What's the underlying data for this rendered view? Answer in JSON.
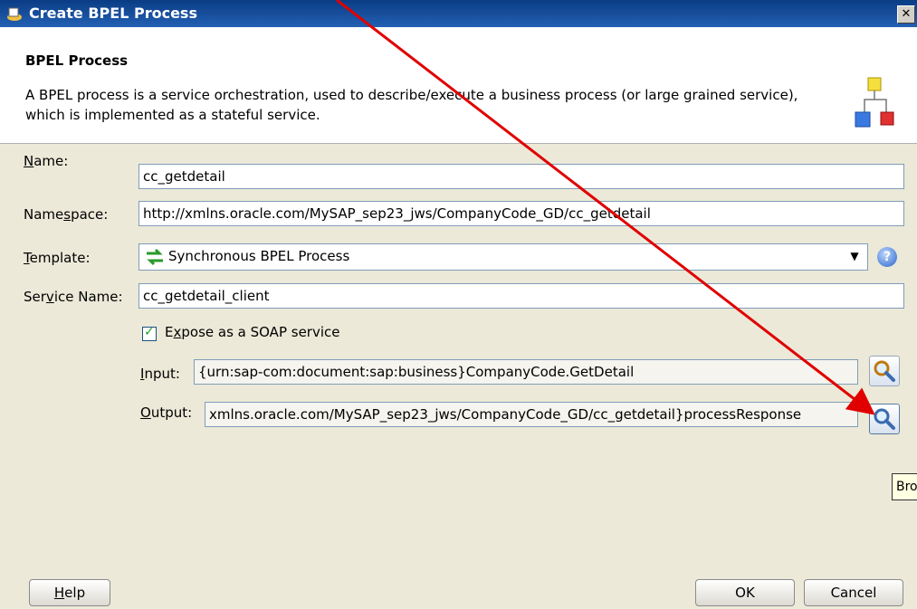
{
  "window": {
    "title": "Create BPEL Process",
    "close_label": "✕"
  },
  "header": {
    "title": "BPEL Process",
    "description": "A BPEL process is a service orchestration, used to describe/execute a business process (or large grained service), which is implemented as a stateful service."
  },
  "form": {
    "name": {
      "label_pre": "",
      "label_u": "N",
      "label_post": "ame:",
      "value": "cc_getdetail"
    },
    "namespace": {
      "label_pre": "Name",
      "label_u": "s",
      "label_post": "pace:",
      "value": "http://xmlns.oracle.com/MySAP_sep23_jws/CompanyCode_GD/cc_getdetail"
    },
    "template": {
      "label_pre": "",
      "label_u": "T",
      "label_post": "emplate:",
      "value": "Synchronous BPEL Process"
    },
    "service_name": {
      "label_pre": "Ser",
      "label_u": "v",
      "label_post": "ice Name:",
      "value": "cc_getdetail_client"
    },
    "expose_soap": {
      "checked": true,
      "label_pre": "E",
      "label_u": "x",
      "label_post": "pose as a SOAP service"
    },
    "input": {
      "label_pre": "",
      "label_u": "I",
      "label_post": "nput:",
      "value": "{urn:sap-com:document:sap:business}CompanyCode.GetDetail"
    },
    "output": {
      "label_pre": "",
      "label_u": "O",
      "label_post": "utput:",
      "value": "xmlns.oracle.com/MySAP_sep23_jws/CompanyCode_GD/cc_getdetail}processResponse"
    }
  },
  "tooltip": {
    "text": "Bro"
  },
  "buttons": {
    "help_pre": "",
    "help_u": "H",
    "help_post": "elp",
    "ok": "OK",
    "cancel": "Cancel"
  },
  "icons": {
    "title": "bpel-process-icon",
    "header": "bpel-diagram-icon",
    "template": "synchronous-process-icon",
    "help": "help-icon",
    "browse": "magnifier-icon",
    "dropdown": "chevron-down-icon"
  },
  "colors": {
    "titlebar": "#0a3c84",
    "dialog_body": "#ece9d8",
    "annotation_arrow": "#e00000"
  }
}
